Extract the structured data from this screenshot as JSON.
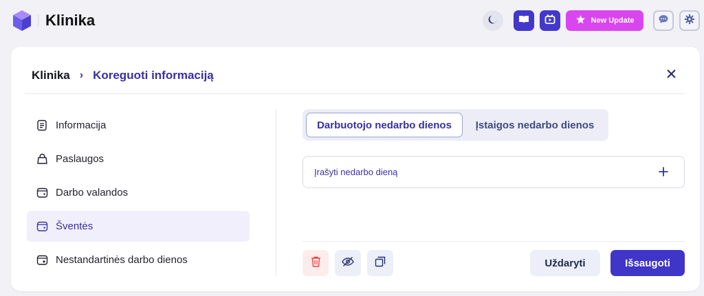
{
  "header": {
    "app_name": "Klinika",
    "new_update_label": "New Update",
    "icons": [
      "logo-icon",
      "moon-icon",
      "book-icon",
      "video-icon",
      "star-icon",
      "chat-icon",
      "gear-icon"
    ]
  },
  "breadcrumb": {
    "root": "Klinika",
    "separator": "›",
    "current": "Koreguoti informaciją"
  },
  "sidebar": {
    "items": [
      {
        "label": "Informacija",
        "icon": "document-icon",
        "active": false
      },
      {
        "label": "Paslaugos",
        "icon": "bag-icon",
        "active": false
      },
      {
        "label": "Darbo valandos",
        "icon": "calendar-icon",
        "active": false
      },
      {
        "label": "Šventės",
        "icon": "calendar-icon",
        "active": true
      },
      {
        "label": "Nestandartinės darbo dienos",
        "icon": "calendar-star-icon",
        "active": false
      }
    ]
  },
  "tabs": [
    {
      "label": "Darbuotojo nedarbo dienos",
      "active": true
    },
    {
      "label": "Įstaigos nedarbo dienos",
      "active": false
    }
  ],
  "entry": {
    "label": "Įrašyti nedarbo dieną",
    "icon": "plus-icon"
  },
  "actions": {
    "cancel_label": "Uždaryti",
    "save_label": "Išsaugoti",
    "icon_buttons": [
      "trash-icon",
      "eye-off-icon",
      "copy-icon"
    ]
  },
  "colors": {
    "accent": "#3730a3",
    "primary_button": "#3f35c9",
    "update_button": "#d946ef",
    "danger": "#ef4444",
    "active_item_bg": "#f1effb"
  }
}
